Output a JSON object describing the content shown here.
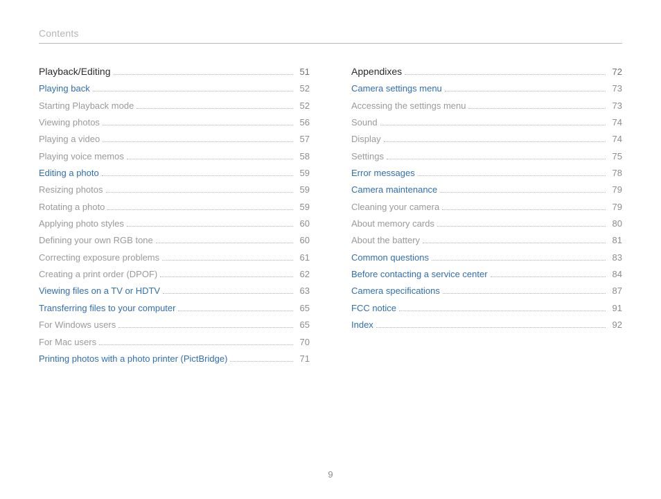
{
  "header": "Contents",
  "page_number": "9",
  "columns": [
    [
      {
        "title": "Playback/Editing",
        "page": "51",
        "style": "section"
      },
      {
        "title": "Playing back",
        "page": "52",
        "style": "link"
      },
      {
        "title": "Starting Playback mode",
        "page": "52",
        "style": "plain"
      },
      {
        "title": "Viewing photos",
        "page": "56",
        "style": "plain"
      },
      {
        "title": "Playing a video",
        "page": "57",
        "style": "plain"
      },
      {
        "title": "Playing voice memos",
        "page": "58",
        "style": "plain"
      },
      {
        "title": "Editing a photo",
        "page": "59",
        "style": "link"
      },
      {
        "title": "Resizing photos",
        "page": "59",
        "style": "plain"
      },
      {
        "title": "Rotating a photo",
        "page": "59",
        "style": "plain"
      },
      {
        "title": "Applying photo styles",
        "page": "60",
        "style": "plain"
      },
      {
        "title": "Defining your own RGB tone",
        "page": "60",
        "style": "plain"
      },
      {
        "title": "Correcting exposure problems",
        "page": "61",
        "style": "plain"
      },
      {
        "title": "Creating a print order (DPOF)",
        "page": "62",
        "style": "plain"
      },
      {
        "title": "Viewing files on a TV or HDTV",
        "page": "63",
        "style": "link"
      },
      {
        "title": "Transferring files to your computer",
        "page": "65",
        "style": "link"
      },
      {
        "title": "For Windows users",
        "page": "65",
        "style": "plain"
      },
      {
        "title": "For Mac users",
        "page": "70",
        "style": "plain"
      },
      {
        "title": "Printing photos with a photo printer (PictBridge)",
        "page": "71",
        "style": "link"
      }
    ],
    [
      {
        "title": "Appendixes",
        "page": "72",
        "style": "section"
      },
      {
        "title": "Camera settings menu",
        "page": "73",
        "style": "link"
      },
      {
        "title": "Accessing the settings menu",
        "page": "73",
        "style": "plain"
      },
      {
        "title": "Sound",
        "page": "74",
        "style": "plain"
      },
      {
        "title": "Display",
        "page": "74",
        "style": "plain"
      },
      {
        "title": "Settings",
        "page": "75",
        "style": "plain"
      },
      {
        "title": "Error messages",
        "page": "78",
        "style": "link"
      },
      {
        "title": "Camera maintenance",
        "page": "79",
        "style": "link"
      },
      {
        "title": "Cleaning your camera",
        "page": "79",
        "style": "plain"
      },
      {
        "title": "About memory cards",
        "page": "80",
        "style": "plain"
      },
      {
        "title": "About the battery",
        "page": "81",
        "style": "plain"
      },
      {
        "title": "Common questions",
        "page": "83",
        "style": "link"
      },
      {
        "title": "Before contacting a service center",
        "page": "84",
        "style": "link"
      },
      {
        "title": "Camera specifications",
        "page": "87",
        "style": "link"
      },
      {
        "title": "FCC notice",
        "page": "91",
        "style": "link"
      },
      {
        "title": "Index",
        "page": "92",
        "style": "link"
      }
    ]
  ]
}
